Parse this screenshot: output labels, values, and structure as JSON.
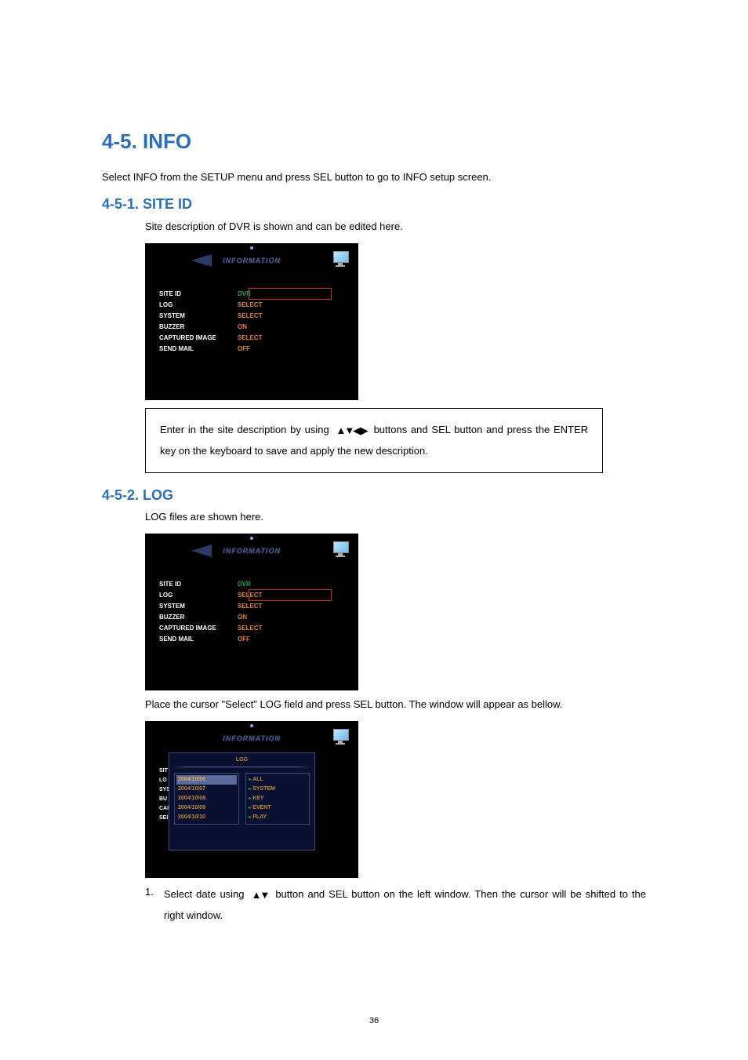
{
  "section": {
    "h1": "4-5. INFO",
    "intro": "Select INFO from the SETUP menu and press SEL button to go to INFO setup screen.",
    "sub1": {
      "title": "4-5-1. SITE ID",
      "desc": "Site description of DVR is shown and can be edited here.",
      "note_part1": "Enter in the site description by using",
      "note_part2": "buttons and SEL button and press the ENTER key on the keyboard to save and apply the new description."
    },
    "sub2": {
      "title": "4-5-2. LOG",
      "desc": "LOG files are shown here.",
      "para": "Place the cursor \"Select\" LOG field and press SEL button. The window will appear as bellow.",
      "li1_num": "1.",
      "li1_a": "Select date using",
      "li1_b": "button and SEL button on the left window. Then the cursor will be shifted to the right window."
    }
  },
  "screenshot_common": {
    "banner": "INFORMATION",
    "menu": [
      {
        "label": "SITE ID",
        "value": "DVR",
        "green": true
      },
      {
        "label": "LOG",
        "value": "SELECT"
      },
      {
        "label": "SYSTEM",
        "value": "SELECT"
      },
      {
        "label": "BUZZER",
        "value": "ON"
      },
      {
        "label": "CAPTURED IMAGE",
        "value": "SELECT"
      },
      {
        "label": "SEND MAIL",
        "value": "OFF"
      }
    ]
  },
  "log_panel": {
    "title": "LOG",
    "side_labels": [
      "SIT",
      "LO",
      "SYS",
      "BU",
      "CAI",
      "SEI"
    ],
    "dates": [
      "2004/10/06",
      "2004/10/07",
      "2004/10/08",
      "2004/10/09",
      "2004/10/10"
    ],
    "selected_date_index": 0,
    "cats": [
      "ALL",
      "SYSTEM",
      "KEY",
      "EVENT",
      "PLAY"
    ]
  },
  "footer": "36"
}
